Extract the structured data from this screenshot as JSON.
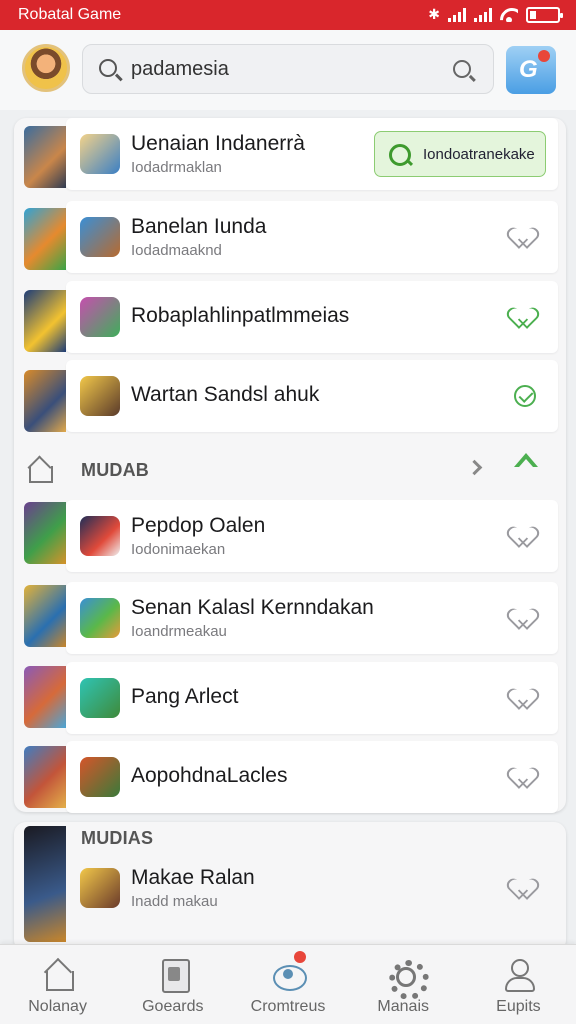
{
  "status_bar": {
    "app_name": "Robatal Game",
    "bluetooth_icon": "bluetooth-icon",
    "signal_icon": "signal-icon",
    "wifi_icon": "wifi-icon",
    "battery_icon": "battery-icon"
  },
  "header": {
    "search": {
      "query": "padamesia",
      "leading_icon": "search-icon",
      "trailing_icon": "search-icon"
    },
    "avatar_icon": "avatar",
    "action_button_label": "G"
  },
  "colors": {
    "status_bar": "#d9262c",
    "accent_green": "#4caf50",
    "install_bg": "#e4f5dc"
  },
  "list": {
    "rows": [
      {
        "title": "Uenaian Indanerrà",
        "subtitle": "Iodadrmaklan",
        "action": "Iondoatranekake"
      },
      {
        "title": "Banelan Iunda",
        "subtitle": "Iodadmaaknd",
        "action": "heart-icon"
      },
      {
        "title": "Robaplahlinpatlmmeias",
        "action": "heart-icon"
      },
      {
        "title": "Wartan Sandsl ahuk",
        "action": "check-icon"
      }
    ],
    "section_1": {
      "label": "MUDAB"
    },
    "rows_2": [
      {
        "title": "Pepdop Oalen",
        "subtitle": "Iodonimaekan",
        "action": "heart-icon"
      },
      {
        "title": "Senan Kalasl Kernndakan",
        "subtitle": "Ioandrmeakau",
        "action": "heart-icon"
      },
      {
        "title": "Pang Arlect",
        "action": "heart-icon"
      },
      {
        "title": "AopohdnaLacles",
        "action": "heart-icon"
      }
    ],
    "section_2": {
      "label": "MUDIAS"
    },
    "rows_3": [
      {
        "title": "Makae Ralan",
        "subtitle": "Inadd makau",
        "action": "heart-icon"
      }
    ]
  },
  "bottom_nav": [
    {
      "label": "Nolanay",
      "icon": "home-icon"
    },
    {
      "label": "Goeards",
      "icon": "boards-icon"
    },
    {
      "label": "Cromtreus",
      "icon": "community-icon"
    },
    {
      "label": "Manais",
      "icon": "gear-icon"
    },
    {
      "label": "Eupits",
      "icon": "user-icon"
    }
  ]
}
